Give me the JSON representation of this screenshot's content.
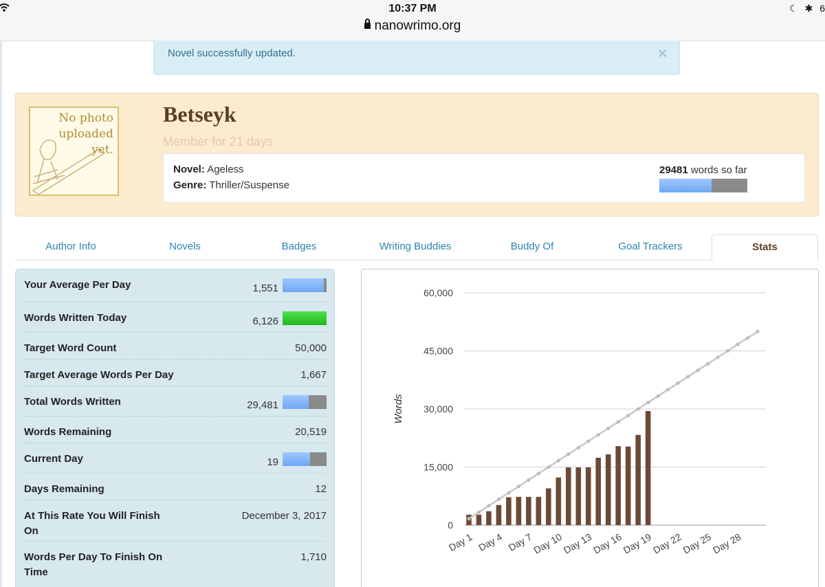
{
  "status_bar": {
    "time": "10:37 PM",
    "url": "nanowrimo.org",
    "battery_partial": "6"
  },
  "alert": {
    "message": "Novel successfully updated.",
    "close_glyph": "×"
  },
  "profile": {
    "photo_placeholder": "No photo uploaded yet.",
    "username": "Betseyk",
    "member_for": "Member for 21 days",
    "novel_label": "Novel:",
    "novel_title": "Ageless",
    "genre_label": "Genre:",
    "genre": "Thriller/Suspense",
    "word_count": "29481",
    "words_suffix": "words so far",
    "progress_fraction": 0.59
  },
  "tabs": [
    {
      "label": "Author Info",
      "active": false
    },
    {
      "label": "Novels",
      "active": false
    },
    {
      "label": "Badges",
      "active": false
    },
    {
      "label": "Writing Buddies",
      "active": false
    },
    {
      "label": "Buddy Of",
      "active": false
    },
    {
      "label": "Goal Trackers",
      "active": false
    },
    {
      "label": "Stats",
      "active": true
    }
  ],
  "stats": [
    {
      "label": "Your Average Per Day",
      "value": "1,551",
      "bar": "blue",
      "fraction": 0.93
    },
    {
      "label": "Words Written Today",
      "value": "6,126",
      "bar": "green",
      "fraction": 1.0
    },
    {
      "label": "Target Word Count",
      "value": "50,000"
    },
    {
      "label": "Target Average Words Per Day",
      "value": "1,667"
    },
    {
      "label": "Total Words Written",
      "value": "29,481",
      "bar": "blue",
      "fraction": 0.59
    },
    {
      "label": "Words Remaining",
      "value": "20,519"
    },
    {
      "label": "Current Day",
      "value": "19",
      "bar": "blue",
      "fraction": 0.63
    },
    {
      "label": "Days Remaining",
      "value": "12"
    },
    {
      "label": "At This Rate You Will Finish On",
      "value": "December 3, 2017"
    },
    {
      "label": "Words Per Day To Finish On Time",
      "value": "1,710"
    }
  ],
  "colors": {
    "bar_brown": "#6b4a37",
    "target_line": "#c8c8c8",
    "link_blue": "#2c84ad",
    "profile_bg": "#fcebcf",
    "stats_bg": "#d8e8ef"
  },
  "chart_data": {
    "type": "bar",
    "ylabel": "Words",
    "ylim": [
      0,
      60000
    ],
    "yticks": [
      "60,000",
      "45,000",
      "30,000",
      "15,000",
      "0"
    ],
    "ytick_values": [
      60000,
      45000,
      30000,
      15000,
      0
    ],
    "x": [
      1,
      2,
      3,
      4,
      5,
      6,
      7,
      8,
      9,
      10,
      11,
      12,
      13,
      14,
      15,
      16,
      17,
      18,
      19,
      20,
      21,
      22,
      23,
      24,
      25,
      26,
      27,
      28,
      29,
      30
    ],
    "xtick_labels": [
      "Day 1",
      "Day 4",
      "Day 7",
      "Day 10",
      "Day 13",
      "Day 16",
      "Day 19",
      "Day 22",
      "Day 25",
      "Day 28"
    ],
    "xtick_days": [
      1,
      4,
      7,
      10,
      13,
      16,
      19,
      22,
      25,
      28
    ],
    "series": [
      {
        "type": "bar",
        "values": [
          2700,
          2700,
          3600,
          5200,
          7200,
          7300,
          7300,
          7300,
          9500,
          12300,
          14900,
          14900,
          14900,
          17400,
          18300,
          20400,
          20300,
          23300,
          29481
        ]
      },
      {
        "type": "line",
        "values": [
          1667,
          3333,
          5000,
          6667,
          8333,
          10000,
          11667,
          13333,
          15000,
          16667,
          18333,
          20000,
          21667,
          23333,
          25000,
          26667,
          28333,
          30000,
          31667,
          33333,
          35000,
          36667,
          38333,
          40000,
          41667,
          43333,
          45000,
          46667,
          48333,
          50000
        ]
      }
    ]
  }
}
